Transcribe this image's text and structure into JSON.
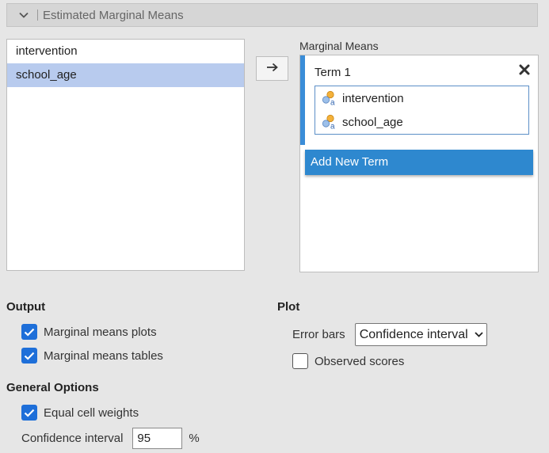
{
  "section": {
    "title": "Estimated Marginal Means",
    "icon": "chevron-down-icon"
  },
  "variables": [
    {
      "label": "intervention",
      "selected": false
    },
    {
      "label": "school_age",
      "selected": true
    }
  ],
  "transfer_button": {
    "icon": "arrow-right-icon"
  },
  "marginal_means": {
    "label": "Marginal Means",
    "term": {
      "title": "Term 1",
      "close_icon": "close-icon",
      "variables": [
        "intervention",
        "school_age"
      ],
      "variable_icon": "nominal-variable-icon"
    },
    "add_button": "Add New Term"
  },
  "output": {
    "heading": "Output",
    "plots_label": "Marginal means plots",
    "plots_checked": true,
    "tables_label": "Marginal means tables",
    "tables_checked": true
  },
  "plot": {
    "heading": "Plot",
    "error_bars_label": "Error bars",
    "error_bars_value": "Confidence interval",
    "observed_label": "Observed scores",
    "observed_checked": false
  },
  "general": {
    "heading": "General Options",
    "equal_weights_label": "Equal cell weights",
    "equal_weights_checked": true,
    "ci_label": "Confidence interval",
    "ci_value": "95",
    "ci_unit": "%"
  },
  "colors": {
    "accent": "#3a8dd8",
    "selected_row": "#b8cbee",
    "checkbox": "#1e6fd9",
    "add_button": "#2e88cf"
  }
}
